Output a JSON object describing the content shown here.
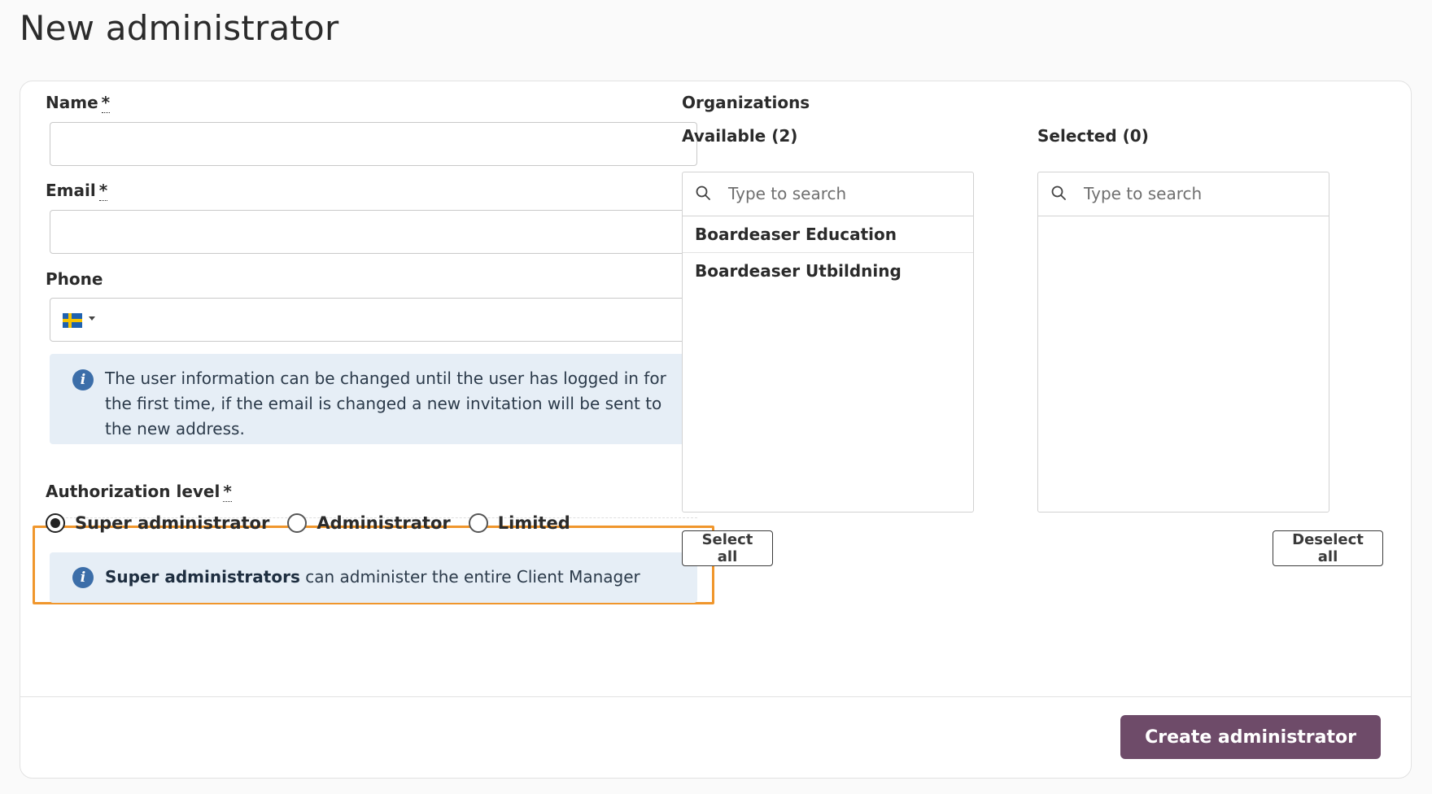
{
  "page": {
    "title": "New administrator"
  },
  "form": {
    "name": {
      "label": "Name",
      "required_mark": "*",
      "value": ""
    },
    "email": {
      "label": "Email",
      "required_mark": "*",
      "value": ""
    },
    "phone": {
      "label": "Phone",
      "country_flag": "sweden-flag-icon",
      "value": ""
    },
    "user_info_note": "The user information can be changed until the user has logged in for the first time, if the email is changed a new invitation will be sent to the new address.",
    "authorization": {
      "label": "Authorization level",
      "required_mark": "*",
      "options": [
        {
          "label": "Super administrator",
          "selected": true
        },
        {
          "label": "Administrator",
          "selected": false
        },
        {
          "label": "Limited",
          "selected": false
        }
      ],
      "note_bold": "Super administrators",
      "note_rest": " can administer the entire Client Manager"
    }
  },
  "organizations": {
    "title": "Organizations",
    "available": {
      "label": "Available (2)",
      "search_placeholder": "Type to search",
      "items": [
        "Boardeaser Education",
        "Boardeaser Utbildning"
      ],
      "select_all_label": "Select all"
    },
    "selected": {
      "label": "Selected (0)",
      "search_placeholder": "Type to search",
      "items": [],
      "deselect_all_label": "Deselect all"
    }
  },
  "footer": {
    "submit_label": "Create administrator"
  },
  "colors": {
    "primary_button": "#6e4b69",
    "info_background": "#e6eef6",
    "info_icon": "#3c6ea9",
    "highlight_border": "#f0962c"
  }
}
